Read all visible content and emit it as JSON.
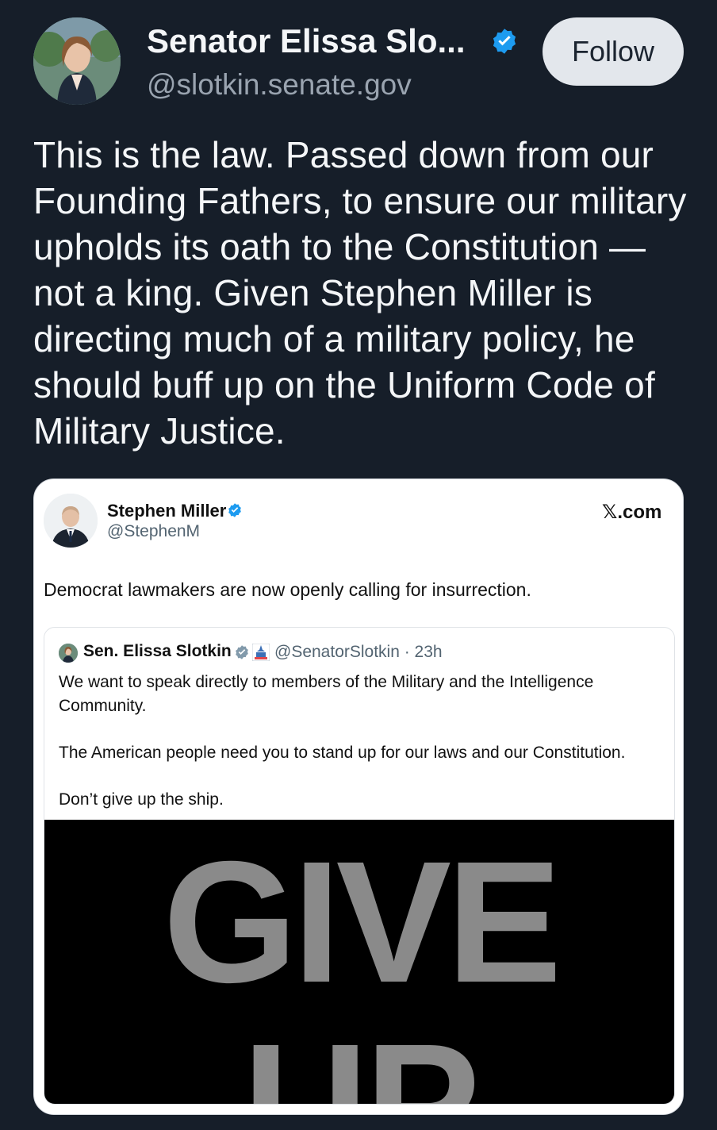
{
  "post": {
    "author": {
      "display_name": "Senator Elissa Slo...",
      "handle": "@slotkin.senate.gov",
      "verified": true
    },
    "follow_label": "Follow",
    "text": "This is the law. Passed down from our Founding Fathers, to ensure our military upholds its oath to the Constitution — not a king. Given Stephen Miller is directing much of a military policy, he should buff up on the Uniform Code of Military Justice."
  },
  "embed": {
    "author": {
      "name": "Stephen Miller",
      "handle": "@StephenM",
      "verified": true
    },
    "source": "𝕏.com",
    "text": "Democrat lawmakers are now openly calling for insurrection.",
    "quote": {
      "name": "Sen. Elissa Slotkin",
      "handle_time": "@SenatorSlotkin · 23h",
      "paragraphs": [
        "We want to speak directly to members of the Military and the Intelligence Community.",
        "The American people need you to stand up for our laws and our Constitution.",
        "Don’t give up the ship."
      ],
      "media_text_line1": "GIVE",
      "media_text_line2": "UP"
    }
  },
  "colors": {
    "background": "#161e29",
    "verified_blue": "#1d9bf0",
    "follow_bg": "#e3e7ec"
  }
}
